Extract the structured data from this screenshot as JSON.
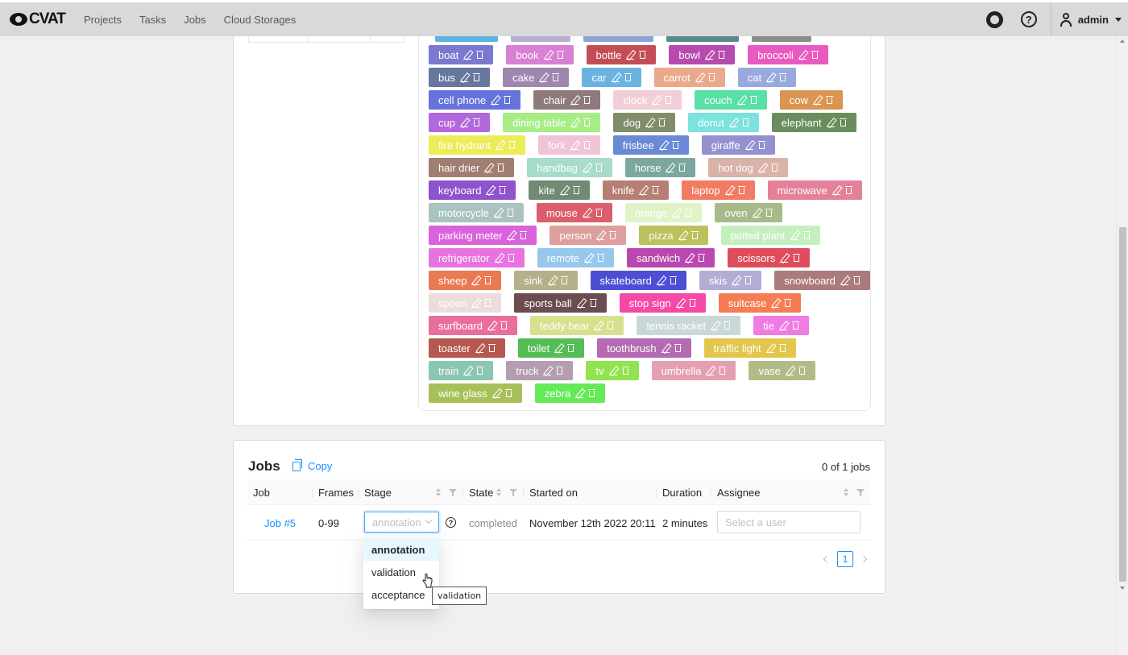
{
  "header": {
    "logo": "CVAT",
    "nav": [
      "Projects",
      "Tasks",
      "Jobs",
      "Cloud Storages"
    ],
    "user": "admin"
  },
  "labels": {
    "rows": [
      [
        {
          "name": "boat",
          "color": "#7a79cf"
        },
        {
          "name": "book",
          "color": "#d97fd4"
        },
        {
          "name": "bottle",
          "color": "#c44d55"
        },
        {
          "name": "bowl",
          "color": "#b74aad"
        },
        {
          "name": "broccoli",
          "color": "#e95ac0"
        }
      ],
      [
        {
          "name": "bus",
          "color": "#6677a0"
        },
        {
          "name": "cake",
          "color": "#9f86ad"
        },
        {
          "name": "car",
          "color": "#6ab3e0"
        },
        {
          "name": "carrot",
          "color": "#e9a98a"
        },
        {
          "name": "cat",
          "color": "#98aadd"
        }
      ],
      [
        {
          "name": "cell phone",
          "color": "#6773dc"
        },
        {
          "name": "chair",
          "color": "#8e7a7c"
        },
        {
          "name": "clock",
          "color": "#f1cfd6"
        },
        {
          "name": "couch",
          "color": "#59e0a7"
        },
        {
          "name": "cow",
          "color": "#db9552"
        }
      ],
      [
        {
          "name": "cup",
          "color": "#b168da"
        },
        {
          "name": "dining table",
          "color": "#a6ed86"
        },
        {
          "name": "dog",
          "color": "#7f8d69"
        },
        {
          "name": "donut",
          "color": "#7be2de"
        },
        {
          "name": "elephant",
          "color": "#6a8d5c"
        }
      ],
      [
        {
          "name": "fire hydrant",
          "color": "#ecec59"
        },
        {
          "name": "fork",
          "color": "#efc3d8"
        },
        {
          "name": "frisbee",
          "color": "#6b8ad6"
        },
        {
          "name": "giraffe",
          "color": "#9590d0"
        }
      ],
      [
        {
          "name": "hair drier",
          "color": "#a07e72"
        },
        {
          "name": "handbag",
          "color": "#a8dcc8"
        },
        {
          "name": "horse",
          "color": "#7ba7a0"
        },
        {
          "name": "hot dog",
          "color": "#d9b2a8"
        }
      ],
      [
        {
          "name": "keyboard",
          "color": "#9152cd"
        },
        {
          "name": "kite",
          "color": "#708a74"
        },
        {
          "name": "knife",
          "color": "#b67f73"
        },
        {
          "name": "laptop",
          "color": "#f27b64"
        },
        {
          "name": "microwave",
          "color": "#e48198"
        }
      ],
      [
        {
          "name": "motorcycle",
          "color": "#a9c4c0"
        },
        {
          "name": "mouse",
          "color": "#dc5d6c"
        },
        {
          "name": "orange",
          "color": "#dff3c8"
        },
        {
          "name": "oven",
          "color": "#a7bb8a"
        }
      ],
      [
        {
          "name": "parking meter",
          "color": "#d963dc"
        },
        {
          "name": "person",
          "color": "#dc9f9d"
        },
        {
          "name": "pizza",
          "color": "#bcc15c"
        },
        {
          "name": "potted plant",
          "color": "#c6efc0"
        }
      ],
      [
        {
          "name": "refrigerator",
          "color": "#e873e0"
        },
        {
          "name": "remote",
          "color": "#96c8ec"
        },
        {
          "name": "sandwich",
          "color": "#b948b0"
        },
        {
          "name": "scissors",
          "color": "#df4d5c"
        }
      ],
      [
        {
          "name": "sheep",
          "color": "#ea7a54"
        },
        {
          "name": "sink",
          "color": "#b5b08a"
        },
        {
          "name": "skateboard",
          "color": "#4c4fd4"
        },
        {
          "name": "skis",
          "color": "#b5acd5"
        },
        {
          "name": "snowboard",
          "color": "#aa7a7c"
        }
      ],
      [
        {
          "name": "spoon",
          "color": "#ecdcdc"
        },
        {
          "name": "sports ball",
          "color": "#6c4c4f"
        },
        {
          "name": "stop sign",
          "color": "#f44aa6"
        },
        {
          "name": "suitcase",
          "color": "#f57c54"
        }
      ],
      [
        {
          "name": "surfboard",
          "color": "#ea6e9c"
        },
        {
          "name": "teddy bear",
          "color": "#d6e08e"
        },
        {
          "name": "tennis racket",
          "color": "#c9d8d6"
        },
        {
          "name": "tie",
          "color": "#ef7ce4"
        }
      ],
      [
        {
          "name": "toaster",
          "color": "#b5584f"
        },
        {
          "name": "toilet",
          "color": "#54bd56"
        },
        {
          "name": "toothbrush",
          "color": "#b46ab4"
        },
        {
          "name": "traffic light",
          "color": "#e3c64c"
        }
      ],
      [
        {
          "name": "train",
          "color": "#8ac7b1"
        },
        {
          "name": "truck",
          "color": "#b49cb1"
        },
        {
          "name": "tv",
          "color": "#91e34f"
        },
        {
          "name": "umbrella",
          "color": "#e59fb2"
        },
        {
          "name": "vase",
          "color": "#b2bb85"
        }
      ],
      [
        {
          "name": "wine glass",
          "color": "#a7c05a"
        },
        {
          "name": "zebra",
          "color": "#65ea57"
        }
      ]
    ]
  },
  "jobs": {
    "title": "Jobs",
    "copy_label": "Copy",
    "count": "0 of 1 jobs",
    "columns": {
      "job": "Job",
      "frames": "Frames",
      "stage": "Stage",
      "state": "State",
      "started": "Started on",
      "duration": "Duration",
      "assignee": "Assignee"
    },
    "row": {
      "job": "Job #5",
      "frames": "0-99",
      "stage": "annotation",
      "state": "completed",
      "started": "November 12th 2022 20:11",
      "duration": "2 minutes",
      "assignee_placeholder": "Select a user"
    },
    "page": "1"
  },
  "stage_dropdown": {
    "options": [
      "annotation",
      "validation",
      "acceptance"
    ],
    "selected": "annotation"
  },
  "tooltip": "validation"
}
